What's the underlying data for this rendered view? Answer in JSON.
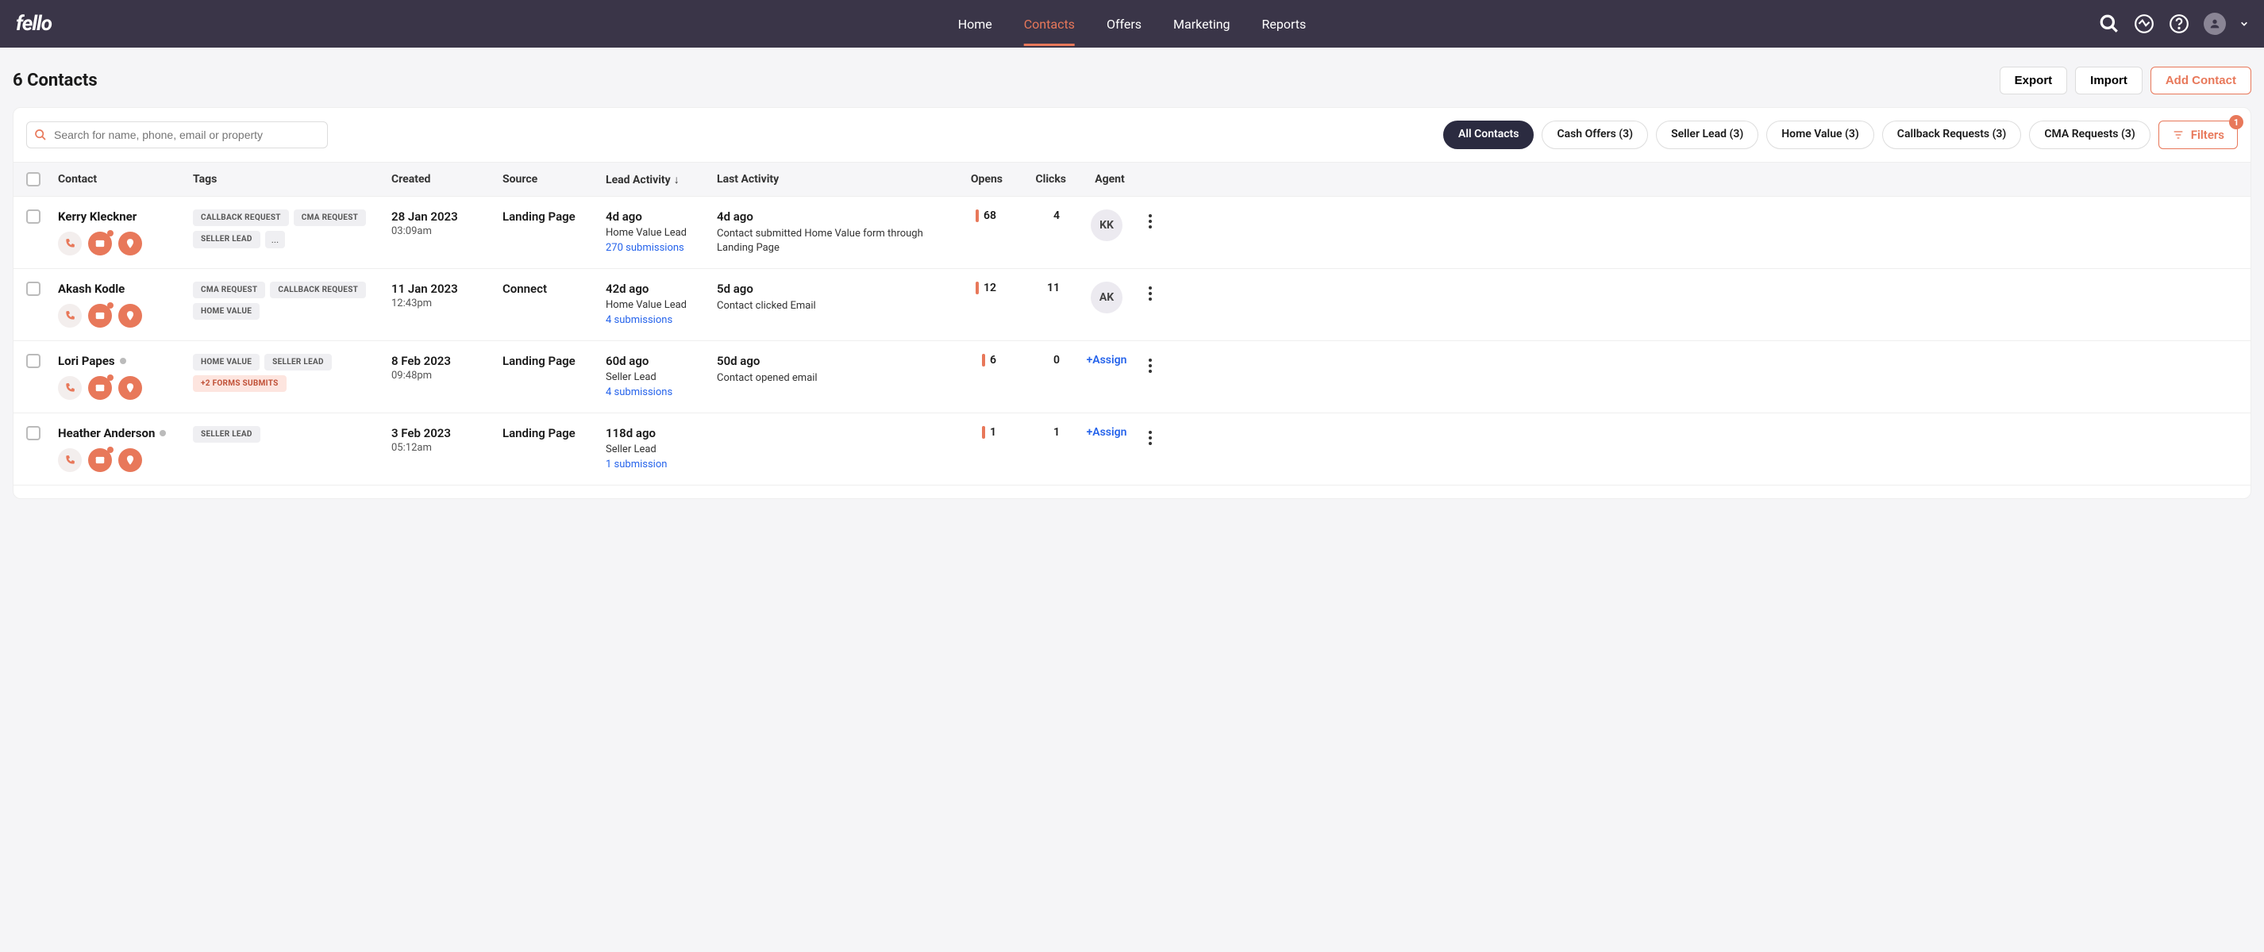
{
  "nav": {
    "logo": "fello",
    "links": [
      "Home",
      "Contacts",
      "Offers",
      "Marketing",
      "Reports"
    ],
    "active_index": 1
  },
  "page": {
    "title": "6 Contacts",
    "export": "Export",
    "import": "Import",
    "add": "Add Contact"
  },
  "search": {
    "placeholder": "Search for name, phone, email or property"
  },
  "chips": [
    "All Contacts",
    "Cash Offers (3)",
    "Seller Lead (3)",
    "Home Value (3)",
    "Callback Requests (3)",
    "CMA Requests (3)"
  ],
  "filters": {
    "label": "Filters",
    "count": "1"
  },
  "columns": {
    "contact": "Contact",
    "tags": "Tags",
    "created": "Created",
    "source": "Source",
    "lead": "Lead Activity",
    "last": "Last Activity",
    "opens": "Opens",
    "clicks": "Clicks",
    "agent": "Agent"
  },
  "rows": [
    {
      "name": "Kerry Kleckner",
      "status_dot": false,
      "tags": [
        "CALLBACK REQUEST",
        "CMA REQUEST",
        "SELLER LEAD"
      ],
      "tags_more": "...",
      "created_date": "28 Jan 2023",
      "created_time": "03:09am",
      "source": "Landing Page",
      "lead_time": "4d ago",
      "lead_type": "Home Value Lead",
      "lead_link": "270 submissions",
      "last_time": "4d ago",
      "last_desc": "Contact submitted Home Value form through Landing Page",
      "opens": "68",
      "clicks": "4",
      "agent_initials": "KK",
      "agent_assign": null
    },
    {
      "name": "Akash Kodle",
      "status_dot": false,
      "tags": [
        "CMA REQUEST",
        "CALLBACK REQUEST",
        "HOME VALUE"
      ],
      "tags_more": null,
      "created_date": "11 Jan 2023",
      "created_time": "12:43pm",
      "source": "Connect",
      "lead_time": "42d ago",
      "lead_type": "Home Value Lead",
      "lead_link": "4 submissions",
      "last_time": "5d ago",
      "last_desc": "Contact clicked Email",
      "opens": "12",
      "clicks": "11",
      "agent_initials": "AK",
      "agent_assign": null
    },
    {
      "name": "Lori Papes",
      "status_dot": true,
      "tags": [
        "HOME VALUE",
        "SELLER LEAD"
      ],
      "forms_tag": "+2 FORMS SUBMITS",
      "tags_more": null,
      "created_date": "8 Feb 2023",
      "created_time": "09:48pm",
      "source": "Landing Page",
      "lead_time": "60d ago",
      "lead_type": "Seller Lead",
      "lead_link": "4 submissions",
      "last_time": "50d ago",
      "last_desc": "Contact opened email",
      "opens": "6",
      "clicks": "0",
      "agent_initials": null,
      "agent_assign": "+Assign"
    },
    {
      "name": "Heather Anderson",
      "status_dot": true,
      "tags": [
        "SELLER LEAD"
      ],
      "tags_more": null,
      "created_date": "3 Feb 2023",
      "created_time": "05:12am",
      "source": "Landing Page",
      "lead_time": "118d ago",
      "lead_type": "Seller Lead",
      "lead_link": "1 submission",
      "last_time": "",
      "last_desc": "",
      "opens": "1",
      "clicks": "1",
      "agent_initials": null,
      "agent_assign": "+Assign"
    }
  ]
}
